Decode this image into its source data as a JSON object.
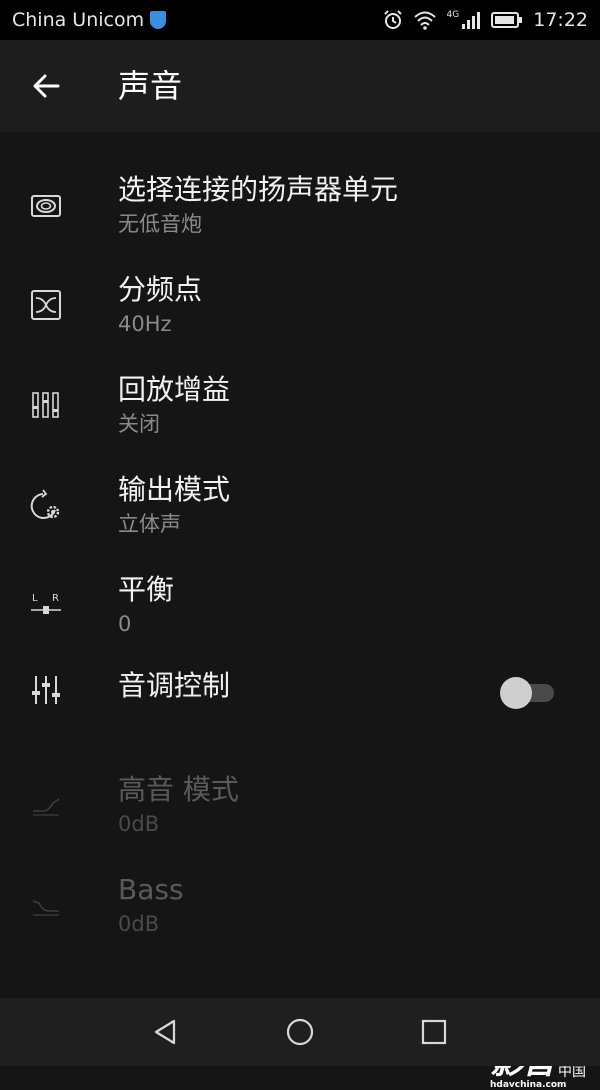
{
  "status_bar": {
    "carrier": "China Unicom",
    "network_type": "4G",
    "time": "17:22",
    "icons": [
      "alarm-icon",
      "wifi-icon",
      "signal-icon",
      "battery-icon"
    ]
  },
  "header": {
    "title": "声音",
    "back_icon": "arrow-left-icon"
  },
  "settings": [
    {
      "title": "选择连接的扬声器单元",
      "subtitle": "无低音炮",
      "icon": "speaker-unit-icon"
    },
    {
      "title": "分频点",
      "subtitle": "40Hz",
      "icon": "crossover-icon"
    },
    {
      "title": "回放增益",
      "subtitle": "关闭",
      "icon": "playback-gain-icon"
    },
    {
      "title": "输出模式",
      "subtitle": "立体声",
      "icon": "output-mode-icon"
    },
    {
      "title": "平衡",
      "subtitle": "0",
      "icon": "balance-icon"
    },
    {
      "title": "音调控制",
      "icon": "equalizer-sliders-icon",
      "toggle_on": false
    },
    {
      "title": "高音 模式",
      "subtitle": "0dB",
      "icon": "treble-icon",
      "disabled": true
    },
    {
      "title": "Bass",
      "subtitle": "0dB",
      "icon": "bass-icon",
      "disabled": true
    }
  ],
  "watermark": {
    "main": "影音",
    "cn": "中国",
    "url": "hdavchina.com"
  },
  "nav_bar": {
    "icons": [
      "back-triangle-icon",
      "home-circle-icon",
      "recents-square-icon"
    ]
  },
  "colors": {
    "background": "#151515",
    "app_bar": "#1d1d1d",
    "status_bar": "#000000",
    "nav_bar": "#1f1f1f",
    "text_primary": "#f2f2f2",
    "text_secondary": "#8a8a8a",
    "text_disabled": "#5a5a5a"
  }
}
